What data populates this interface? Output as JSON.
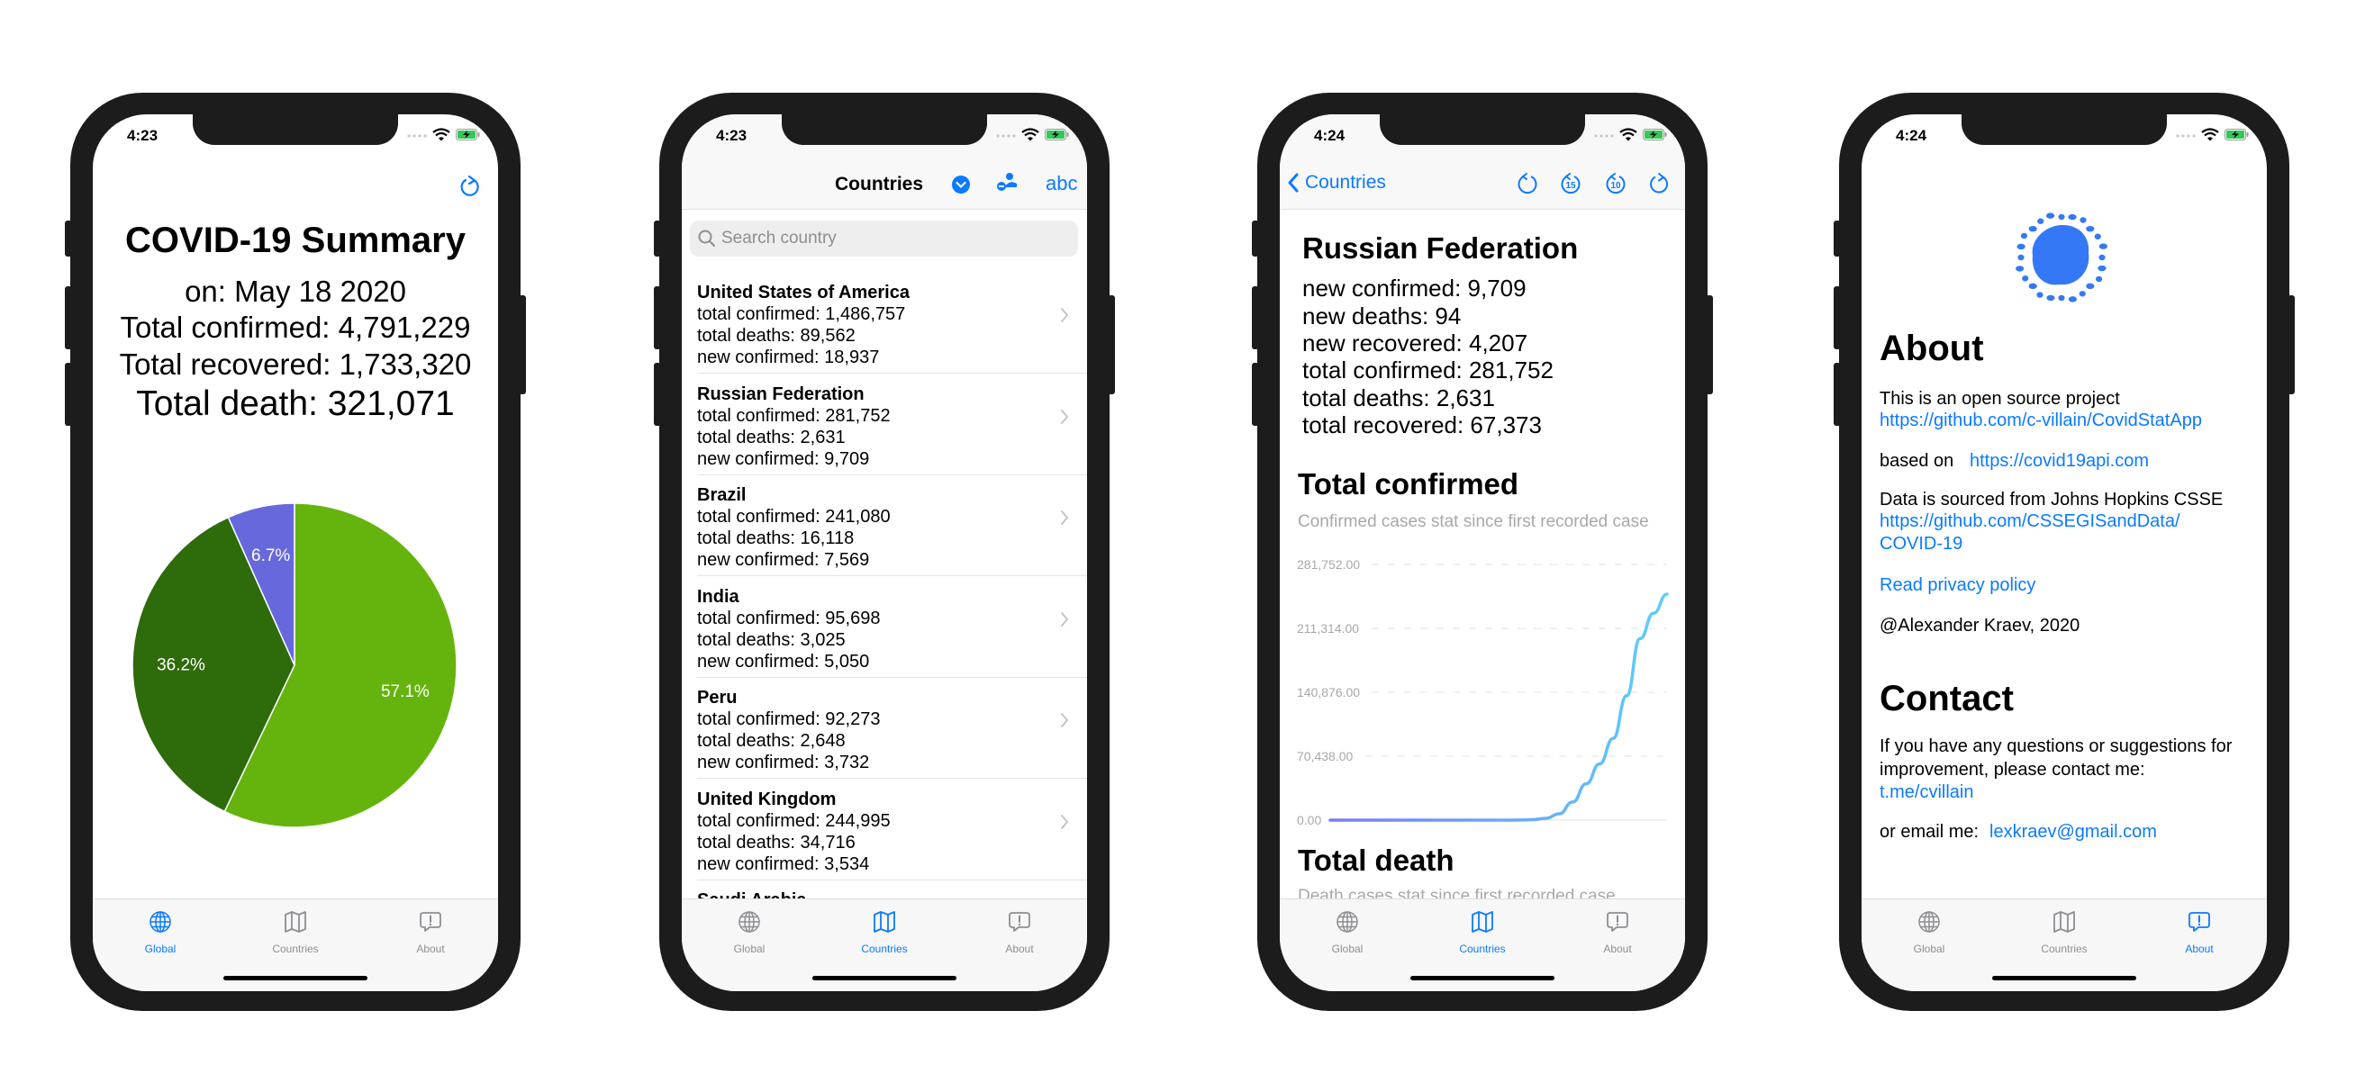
{
  "colors": {
    "accent": "#0a7aff",
    "pie_light_green": "#65b40d",
    "pie_dark_green": "#2e6b0b",
    "pie_purple": "#6868dd",
    "chart_line": "#5ccffb"
  },
  "tabs": [
    {
      "label": "Global",
      "icon": "globe-icon"
    },
    {
      "label": "Countries",
      "icon": "map-icon"
    },
    {
      "label": "About",
      "icon": "exclamation-bubble-icon"
    }
  ],
  "global": {
    "time": "4:23",
    "refresh_icon": "refresh-icon",
    "title": "COVID-19 Summary",
    "date": "on: May 18 2020",
    "confirmed": "Total confirmed: 4,791,229",
    "recovered": "Total recovered:  1,733,320",
    "death": "Total death: 321,071"
  },
  "countries": {
    "time": "4:23",
    "title": "Countries",
    "sort_abc": "abc",
    "search_placeholder": "Search country",
    "rows": [
      {
        "name": "United States of America",
        "l1": "total confirmed: 1,486,757",
        "l2": "total deaths: 89,562",
        "l3": "new confirmed: 18,937"
      },
      {
        "name": "Russian Federation",
        "l1": "total confirmed: 281,752",
        "l2": "total deaths: 2,631",
        "l3": "new confirmed: 9,709"
      },
      {
        "name": "Brazil",
        "l1": "total confirmed: 241,080",
        "l2": "total deaths: 16,118",
        "l3": "new confirmed: 7,569"
      },
      {
        "name": "India",
        "l1": "total confirmed: 95,698",
        "l2": "total deaths: 3,025",
        "l3": "new confirmed: 5,050"
      },
      {
        "name": "Peru",
        "l1": "total confirmed: 92,273",
        "l2": "total deaths: 2,648",
        "l3": "new confirmed: 3,732"
      },
      {
        "name": "United Kingdom",
        "l1": "total confirmed: 244,995",
        "l2": "total deaths: 34,716",
        "l3": "new confirmed: 3,534"
      },
      {
        "name": "Saudi Arabia",
        "l1": "",
        "l2": "",
        "l3": ""
      }
    ]
  },
  "detail": {
    "time": "4:24",
    "back_label": "Countries",
    "country": "Russian Federation",
    "stats": [
      "new confirmed: 9,709",
      "new deaths: 94",
      "new recovered: 4,207",
      "total confirmed: 281,752",
      "total deaths: 2,631",
      "total recovered: 67,373"
    ],
    "confirmed_title": "Total confirmed",
    "confirmed_subtitle": "Confirmed cases stat since first recorded case",
    "death_title": "Total death",
    "death_subtitle": "Death cases stat since first recorded case"
  },
  "about": {
    "time": "4:24",
    "title": "About",
    "open_source": "This is an open source project",
    "repo_link": "https://github.com/c-villain/CovidStatApp",
    "based_on": "based on",
    "api_link": "https://covid19api.com",
    "sourced": "Data is sourced from Johns Hopkins CSSE",
    "csse_link_1": "https://github.com/CSSEGISandData/",
    "csse_link_2": "COVID-19",
    "privacy": "Read privacy policy",
    "copyright": "@Alexander Kraev, 2020",
    "contact_title": "Contact",
    "contact_1": "If you have any questions or suggestions for",
    "contact_2": "improvement, please contact me:",
    "telegram": "t.me/cvillain",
    "email_label": "or email me:",
    "email": "lexkraev@gmail.com"
  },
  "chart_data": [
    {
      "type": "pie",
      "values": [
        57.1,
        36.2,
        6.7
      ],
      "labels": [
        "57.1%",
        "36.2%",
        "6.7%"
      ],
      "colors": [
        "#65b40d",
        "#2e6b0b",
        "#6868dd"
      ]
    },
    {
      "type": "line",
      "title": "Total confirmed",
      "subtitle": "Confirmed cases stat since first recorded case",
      "ylim": [
        0,
        281752
      ],
      "yticks": [
        "0.00",
        "70,438.00",
        "140,876.00",
        "211,314.00",
        "281,752.00"
      ],
      "ytick_values": [
        0,
        70438,
        140876,
        211314,
        281752
      ],
      "grid": true,
      "values": [
        0,
        0,
        0,
        0,
        0,
        0,
        0,
        0,
        0,
        0,
        0,
        0,
        0,
        0,
        100,
        500,
        2000,
        7000,
        20000,
        40000,
        62000,
        90000,
        137000,
        200000,
        228000,
        249000
      ]
    }
  ]
}
